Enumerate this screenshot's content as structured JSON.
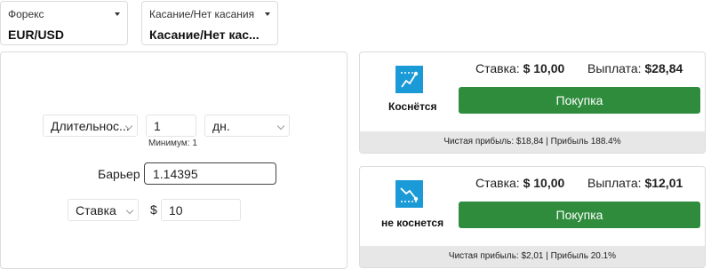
{
  "market": {
    "label": "Форекс",
    "value": "EUR/USD"
  },
  "contract_type": {
    "label": "Касание/Нет касания",
    "value": "Касание/Нет кас..."
  },
  "form": {
    "duration_select": "Длительнос...",
    "duration_value": "1",
    "duration_unit": "дн.",
    "duration_min": "Минимум: 1",
    "barrier_label": "Барьер",
    "barrier_value": "1.14395",
    "basis_select": "Ставка",
    "currency_symbol": "$",
    "amount_value": "10"
  },
  "offers": [
    {
      "name": "Коснётся",
      "icon": "touch-icon",
      "stake_label": "Ставка:",
      "stake_value": "$ 10,00",
      "payout_label": "Выплата:",
      "payout_value": "$28,84",
      "buy_label": "Покупка",
      "footer": "Чистая прибыль: $18,84 | Прибыль 188.4%"
    },
    {
      "name": "не коснется",
      "icon": "no-touch-icon",
      "stake_label": "Ставка:",
      "stake_value": "$ 10,00",
      "payout_label": "Выплата:",
      "payout_value": "$12,01",
      "buy_label": "Покупка",
      "footer": "Чистая прибыль: $2,01 | Прибыль 20.1%"
    }
  ],
  "colors": {
    "buy_button": "#2e8c3c",
    "icon_bg": "#1a9ad6",
    "footer_bg": "#e7e7e7"
  }
}
